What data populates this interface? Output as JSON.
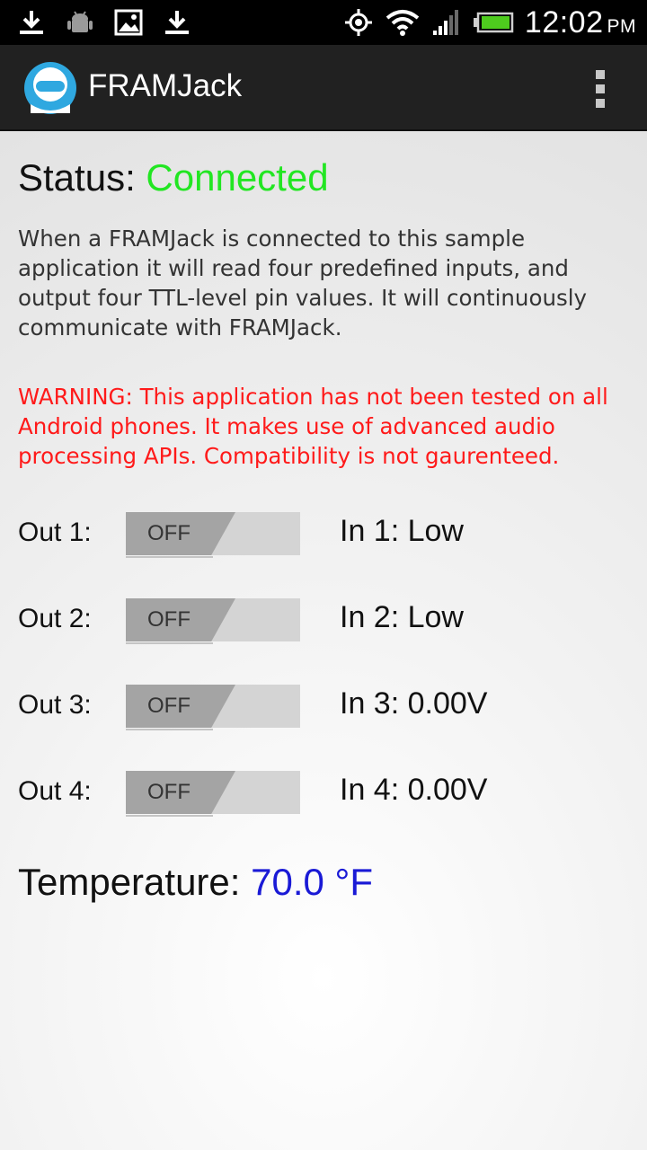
{
  "status_bar": {
    "left_icons": [
      "download-icon",
      "android-debug-icon",
      "image-icon",
      "download-icon"
    ],
    "right_icons": [
      "gps-icon",
      "wifi-icon",
      "cell-signal-icon",
      "battery-icon"
    ],
    "time": "12:02",
    "ampm": "PM"
  },
  "action_bar": {
    "app_icon": "framjack-logo-icon",
    "title": "FRAMJack",
    "overflow_icon": "overflow-menu-icon"
  },
  "status": {
    "label": "Status:",
    "value": "Connected",
    "value_color": "#22e622"
  },
  "description": "When a FRAMJack is connected to this sample application it will read four predefined inputs, and output four TTL-level pin values. It will continuously communicate with FRAMJack.",
  "warning": {
    "text": "WARNING: This application has not been tested on all Android phones. It makes use of advanced audio processing APIs. Compatibility is not gaurenteed.",
    "color": "#ff1a1a"
  },
  "io_rows": [
    {
      "out_label": "Out 1:",
      "toggle_state": "OFF",
      "in_label": "In 1: Low"
    },
    {
      "out_label": "Out 2:",
      "toggle_state": "OFF",
      "in_label": "In 2: Low"
    },
    {
      "out_label": "Out 3:",
      "toggle_state": "OFF",
      "in_label": "In 3: 0.00V"
    },
    {
      "out_label": "Out 4:",
      "toggle_state": "OFF",
      "in_label": "In 4: 0.00V"
    }
  ],
  "temperature": {
    "label": "Temperature:",
    "value": "70.0 °F",
    "value_color": "#1a1ad6"
  }
}
